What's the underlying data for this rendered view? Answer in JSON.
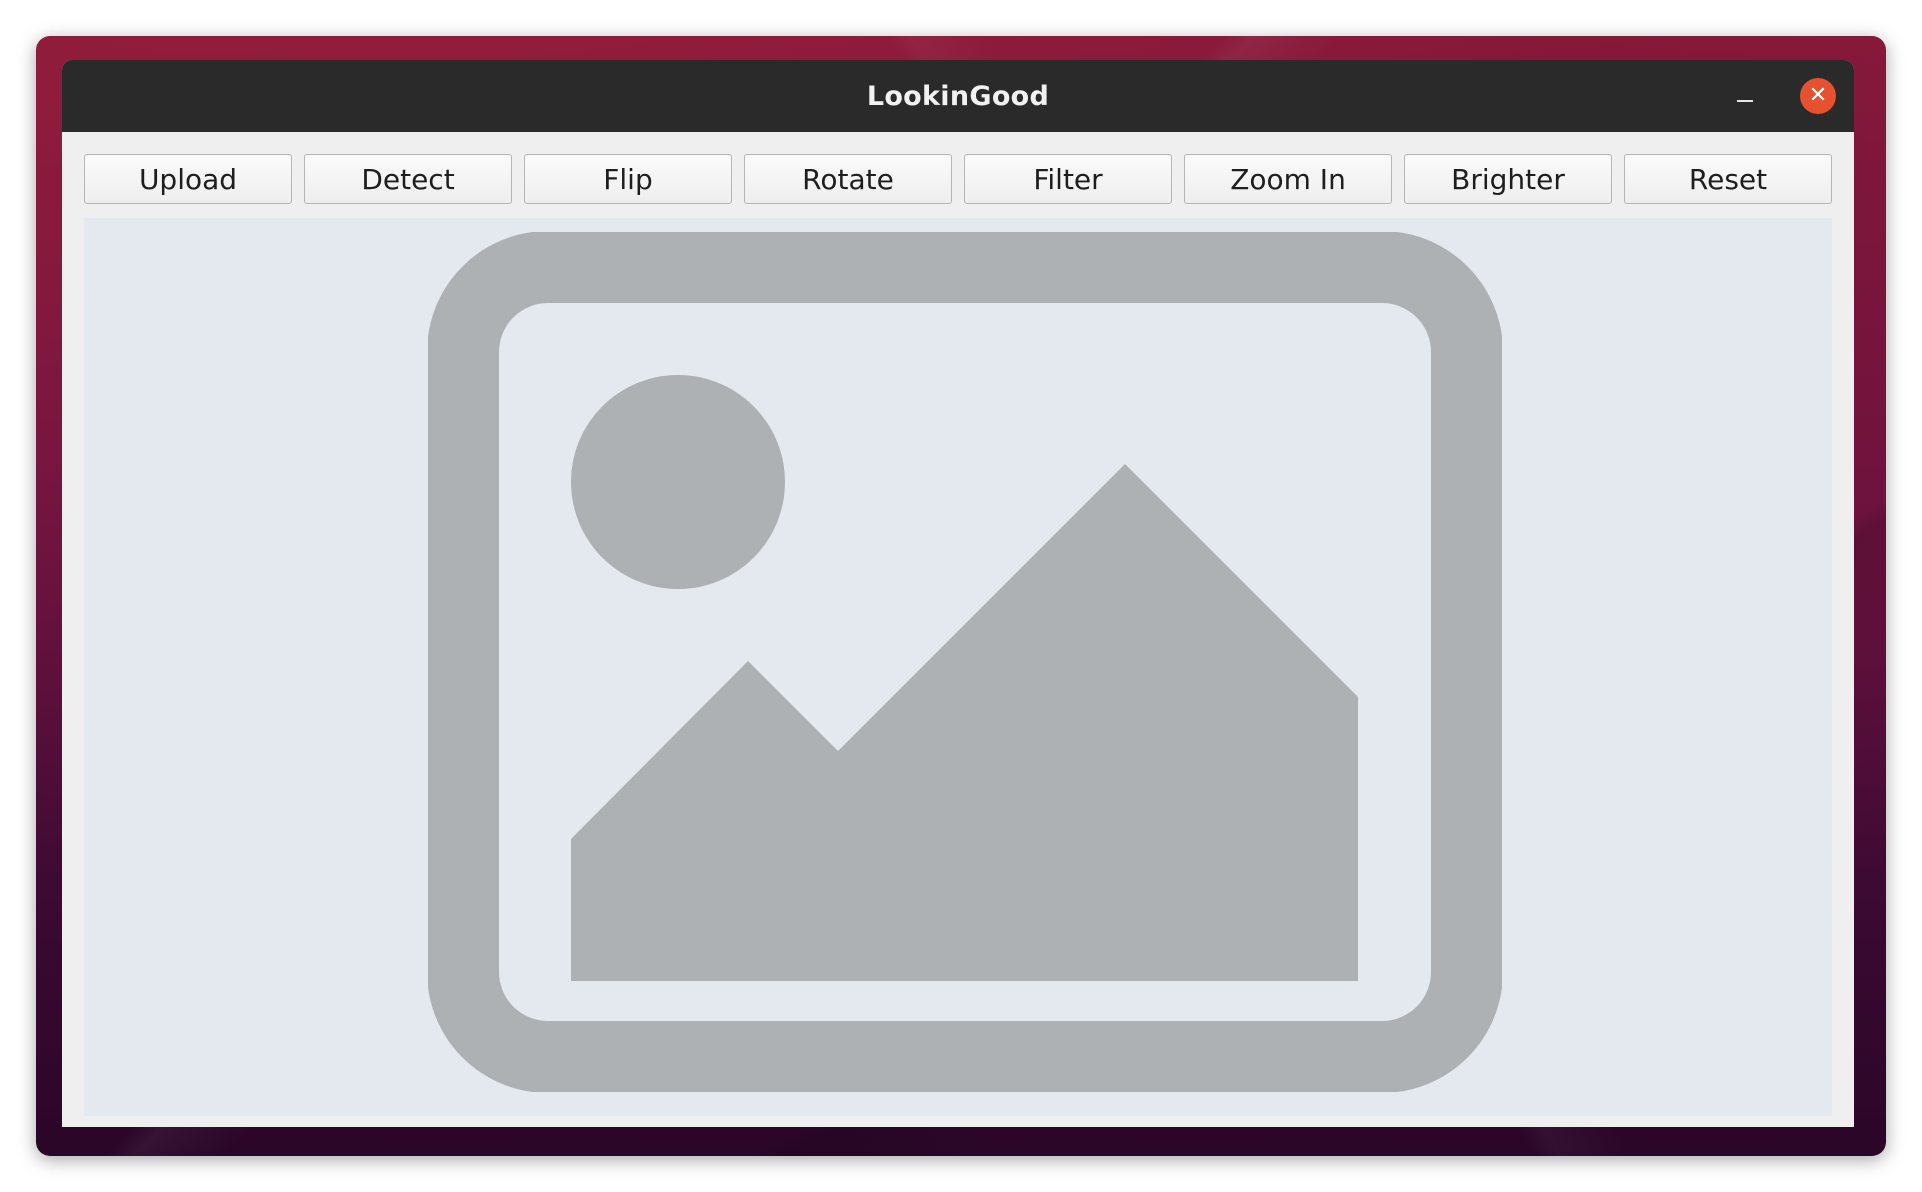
{
  "window": {
    "title": "LookinGood"
  },
  "titlebar": {
    "minimize_icon": "minimize-icon",
    "close_icon": "close-icon",
    "close_glyph": "✕"
  },
  "toolbar": {
    "buttons": [
      {
        "label": "Upload"
      },
      {
        "label": "Detect"
      },
      {
        "label": "Flip"
      },
      {
        "label": "Rotate"
      },
      {
        "label": "Filter"
      },
      {
        "label": "Zoom In"
      },
      {
        "label": "Brighter"
      },
      {
        "label": "Reset"
      }
    ]
  },
  "image_area": {
    "placeholder_icon": "image-placeholder-icon"
  },
  "colors": {
    "titlebar": "#2b2a2b",
    "close_button": "#e6512f",
    "canvas_background": "#e4e8ef",
    "placeholder_gray": "#aeb1b4"
  }
}
